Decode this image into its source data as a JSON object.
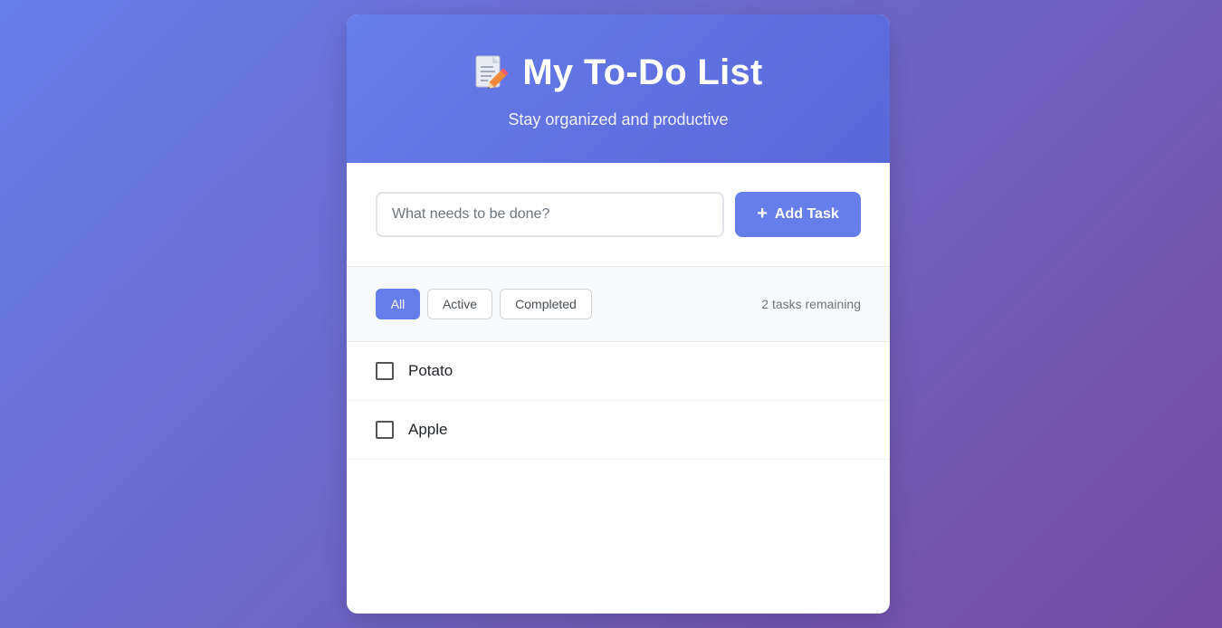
{
  "header": {
    "icon": "memo-pencil-icon",
    "title": "My To-Do List",
    "subtitle": "Stay organized and productive"
  },
  "add_form": {
    "input_placeholder": "What needs to be done?",
    "input_value": "",
    "add_button_icon": "+",
    "add_button_label": "Add Task"
  },
  "filters": {
    "items": [
      {
        "label": "All",
        "active": true
      },
      {
        "label": "Active",
        "active": false
      },
      {
        "label": "Completed",
        "active": false
      }
    ],
    "remaining_text": "2 tasks remaining"
  },
  "tasks": [
    {
      "text": "Potato",
      "completed": false
    },
    {
      "text": "Apple",
      "completed": false
    }
  ],
  "colors": {
    "accent": "#667eea",
    "gradient_start": "#667eea",
    "gradient_end": "#764ba2"
  }
}
